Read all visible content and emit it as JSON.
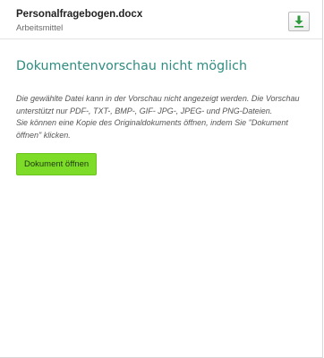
{
  "header": {
    "file_name": "Personalfragebogen.docx",
    "category": "Arbeitsmittel",
    "download_icon": "download-icon",
    "accent_color": "#2e9a3c"
  },
  "preview": {
    "title": "Dokumentenvorschau nicht möglich",
    "message_line1": "Die gewählte Datei kann in der Vorschau nicht angezeigt werden. Die Vorschau unterstützt nur PDF-, TXT-, BMP-, GIF- JPG-, JPEG- und PNG-Dateien.",
    "message_line2": "Sie können eine Kopie des Originaldokuments öffnen, indem Sie \"Dokument öffnen\" klicken.",
    "open_button_label": "Dokument öffnen",
    "title_color": "#2e8c80",
    "button_color": "#7ddc28"
  }
}
